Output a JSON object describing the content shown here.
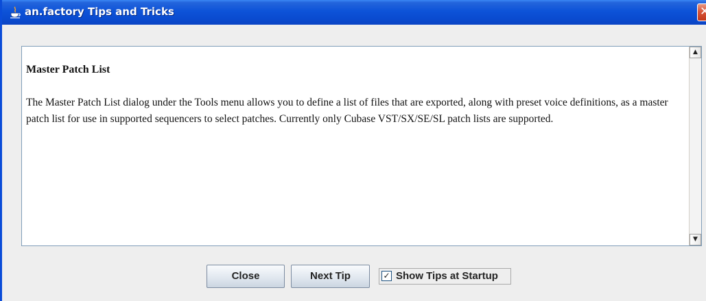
{
  "window": {
    "title": "an.factory Tips and Tricks",
    "close_glyph": "✕"
  },
  "tip": {
    "title": "Master Patch List",
    "body": "The Master Patch List dialog under the Tools menu allows you to define a list of files that are exported, along with preset voice definitions, as a master patch list for use in supported sequencers to select patches. Currently only Cubase VST/SX/SE/SL patch lists are supported."
  },
  "scrollbar": {
    "up_glyph": "▲",
    "down_glyph": "▼"
  },
  "buttons": {
    "close_label": "Close",
    "next_tip_label": "Next Tip"
  },
  "startup_checkbox": {
    "label": "Show Tips at Startup",
    "checked": true,
    "check_glyph": "✓"
  },
  "icons": {
    "title_icon": "java-coffee-cup-icon"
  },
  "colors": {
    "titlebar": "#0a4bd0",
    "close_button": "#d8553a",
    "dialog_background": "#eeeeee",
    "content_background": "#ffffff"
  }
}
